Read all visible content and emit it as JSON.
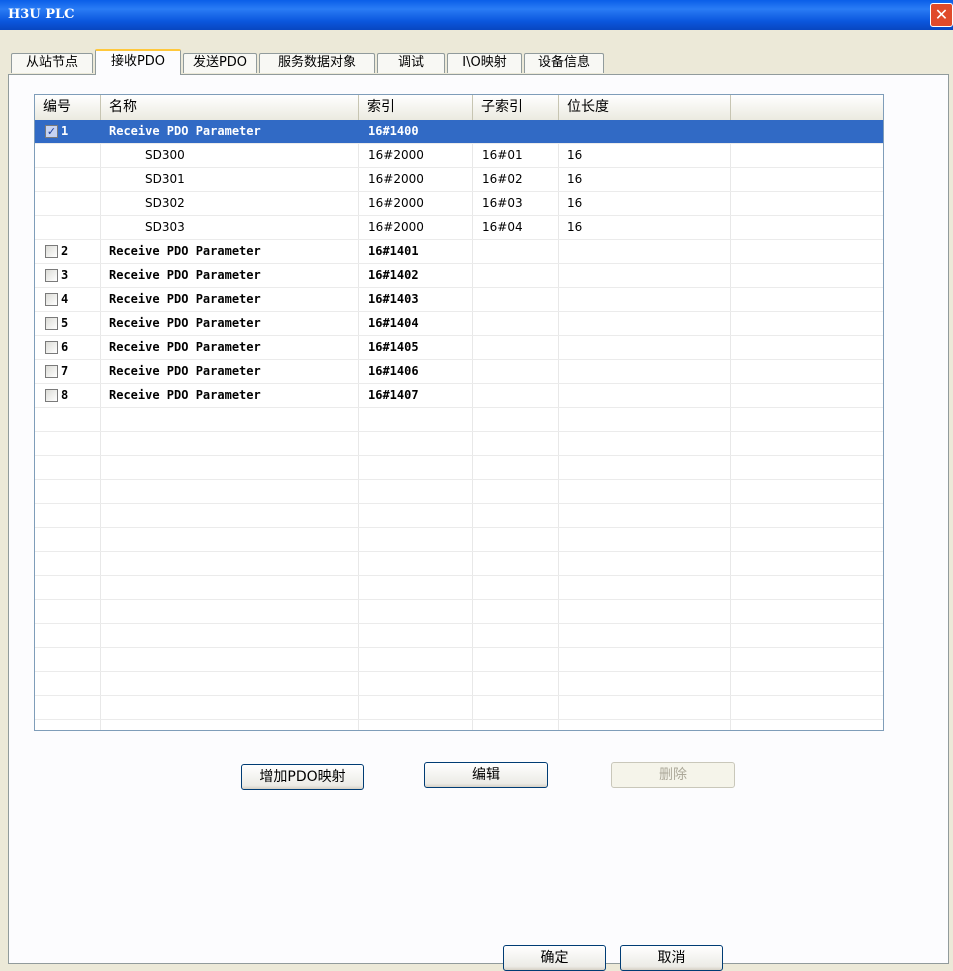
{
  "window": {
    "title": "H3U PLC",
    "close_glyph": "✕"
  },
  "tabs": [
    {
      "label": "从站节点",
      "active": false
    },
    {
      "label": "接收PDO",
      "active": true
    },
    {
      "label": "发送PDO",
      "active": false
    },
    {
      "label": "服务数据对象",
      "active": false
    },
    {
      "label": "调试",
      "active": false
    },
    {
      "label": "I\\O映射",
      "active": false
    },
    {
      "label": "设备信息",
      "active": false
    }
  ],
  "table": {
    "columns": [
      "编号",
      "名称",
      "索引",
      "子索引",
      "位长度"
    ],
    "rows": [
      {
        "kind": "pdo",
        "checked": true,
        "selected": true,
        "num": "1",
        "name": "Receive PDO Parameter",
        "index": "16#1400",
        "subindex": "",
        "bitlen": ""
      },
      {
        "kind": "entry",
        "num": "",
        "name": "SD300",
        "index": "16#2000",
        "subindex": "16#01",
        "bitlen": "16"
      },
      {
        "kind": "entry",
        "num": "",
        "name": "SD301",
        "index": "16#2000",
        "subindex": "16#02",
        "bitlen": "16"
      },
      {
        "kind": "entry",
        "num": "",
        "name": "SD302",
        "index": "16#2000",
        "subindex": "16#03",
        "bitlen": "16"
      },
      {
        "kind": "entry",
        "num": "",
        "name": "SD303",
        "index": "16#2000",
        "subindex": "16#04",
        "bitlen": "16"
      },
      {
        "kind": "pdo",
        "checked": false,
        "num": "2",
        "name": "Receive PDO Parameter",
        "index": "16#1401",
        "subindex": "",
        "bitlen": ""
      },
      {
        "kind": "pdo",
        "checked": false,
        "num": "3",
        "name": "Receive PDO Parameter",
        "index": "16#1402",
        "subindex": "",
        "bitlen": ""
      },
      {
        "kind": "pdo",
        "checked": false,
        "num": "4",
        "name": "Receive PDO Parameter",
        "index": "16#1403",
        "subindex": "",
        "bitlen": ""
      },
      {
        "kind": "pdo",
        "checked": false,
        "num": "5",
        "name": "Receive PDO Parameter",
        "index": "16#1404",
        "subindex": "",
        "bitlen": ""
      },
      {
        "kind": "pdo",
        "checked": false,
        "num": "6",
        "name": "Receive PDO Parameter",
        "index": "16#1405",
        "subindex": "",
        "bitlen": ""
      },
      {
        "kind": "pdo",
        "checked": false,
        "num": "7",
        "name": "Receive PDO Parameter",
        "index": "16#1406",
        "subindex": "",
        "bitlen": ""
      },
      {
        "kind": "pdo",
        "checked": false,
        "num": "8",
        "name": "Receive PDO Parameter",
        "index": "16#1407",
        "subindex": "",
        "bitlen": ""
      }
    ]
  },
  "buttons": {
    "add_pdo_mapping": "增加PDO映射",
    "edit": "编辑",
    "delete": "删除",
    "ok": "确定",
    "cancel": "取消"
  },
  "colors": {
    "title_bar": "#0a5ee8",
    "selection": "#316ac5",
    "close": "#e04a2a"
  }
}
